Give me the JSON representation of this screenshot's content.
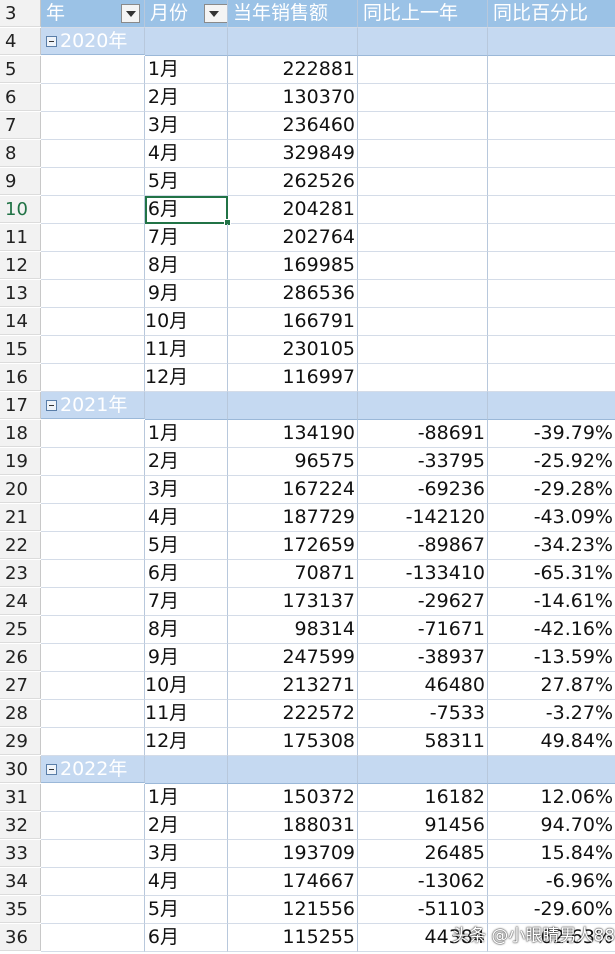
{
  "header": {
    "row_number": "3",
    "col_year": "年",
    "col_month": "月份",
    "col_sales": "当年销售额",
    "col_diff": "同比上一年",
    "col_pct": "同比百分比"
  },
  "active_row": "10",
  "rows": [
    {
      "n": "4",
      "type": "group",
      "year": "2020年"
    },
    {
      "n": "5",
      "month": "1月",
      "sales": "222881",
      "diff": "",
      "pct": ""
    },
    {
      "n": "6",
      "month": "2月",
      "sales": "130370",
      "diff": "",
      "pct": ""
    },
    {
      "n": "7",
      "month": "3月",
      "sales": "236460",
      "diff": "",
      "pct": ""
    },
    {
      "n": "8",
      "month": "4月",
      "sales": "329849",
      "diff": "",
      "pct": ""
    },
    {
      "n": "9",
      "month": "5月",
      "sales": "262526",
      "diff": "",
      "pct": ""
    },
    {
      "n": "10",
      "month": "6月",
      "sales": "204281",
      "diff": "",
      "pct": "",
      "selected": true
    },
    {
      "n": "11",
      "month": "7月",
      "sales": "202764",
      "diff": "",
      "pct": ""
    },
    {
      "n": "12",
      "month": "8月",
      "sales": "169985",
      "diff": "",
      "pct": ""
    },
    {
      "n": "13",
      "month": "9月",
      "sales": "286536",
      "diff": "",
      "pct": ""
    },
    {
      "n": "14",
      "month": "10月",
      "sales": "166791",
      "diff": "",
      "pct": ""
    },
    {
      "n": "15",
      "month": "11月",
      "sales": "230105",
      "diff": "",
      "pct": ""
    },
    {
      "n": "16",
      "month": "12月",
      "sales": "116997",
      "diff": "",
      "pct": ""
    },
    {
      "n": "17",
      "type": "group",
      "year": "2021年"
    },
    {
      "n": "18",
      "month": "1月",
      "sales": "134190",
      "diff": "-88691",
      "pct": "-39.79%"
    },
    {
      "n": "19",
      "month": "2月",
      "sales": "96575",
      "diff": "-33795",
      "pct": "-25.92%"
    },
    {
      "n": "20",
      "month": "3月",
      "sales": "167224",
      "diff": "-69236",
      "pct": "-29.28%"
    },
    {
      "n": "21",
      "month": "4月",
      "sales": "187729",
      "diff": "-142120",
      "pct": "-43.09%"
    },
    {
      "n": "22",
      "month": "5月",
      "sales": "172659",
      "diff": "-89867",
      "pct": "-34.23%"
    },
    {
      "n": "23",
      "month": "6月",
      "sales": "70871",
      "diff": "-133410",
      "pct": "-65.31%"
    },
    {
      "n": "24",
      "month": "7月",
      "sales": "173137",
      "diff": "-29627",
      "pct": "-14.61%"
    },
    {
      "n": "25",
      "month": "8月",
      "sales": "98314",
      "diff": "-71671",
      "pct": "-42.16%"
    },
    {
      "n": "26",
      "month": "9月",
      "sales": "247599",
      "diff": "-38937",
      "pct": "-13.59%"
    },
    {
      "n": "27",
      "month": "10月",
      "sales": "213271",
      "diff": "46480",
      "pct": "27.87%"
    },
    {
      "n": "28",
      "month": "11月",
      "sales": "222572",
      "diff": "-7533",
      "pct": "-3.27%"
    },
    {
      "n": "29",
      "month": "12月",
      "sales": "175308",
      "diff": "58311",
      "pct": "49.84%"
    },
    {
      "n": "30",
      "type": "group",
      "year": "2022年"
    },
    {
      "n": "31",
      "month": "1月",
      "sales": "150372",
      "diff": "16182",
      "pct": "12.06%"
    },
    {
      "n": "32",
      "month": "2月",
      "sales": "188031",
      "diff": "91456",
      "pct": "94.70%"
    },
    {
      "n": "33",
      "month": "3月",
      "sales": "193709",
      "diff": "26485",
      "pct": "15.84%"
    },
    {
      "n": "34",
      "month": "4月",
      "sales": "174667",
      "diff": "-13062",
      "pct": "-6.96%"
    },
    {
      "n": "35",
      "month": "5月",
      "sales": "121556",
      "diff": "-51103",
      "pct": "-29.60%"
    },
    {
      "n": "36",
      "month": "6月",
      "sales": "115255",
      "diff": "44384",
      "pct": "62.63%"
    }
  ],
  "watermark": "头条 @小眼睛男人88",
  "colors": {
    "header_bg": "#9bc2e6",
    "group_bg": "#c5d9f1",
    "selection": "#217346"
  }
}
